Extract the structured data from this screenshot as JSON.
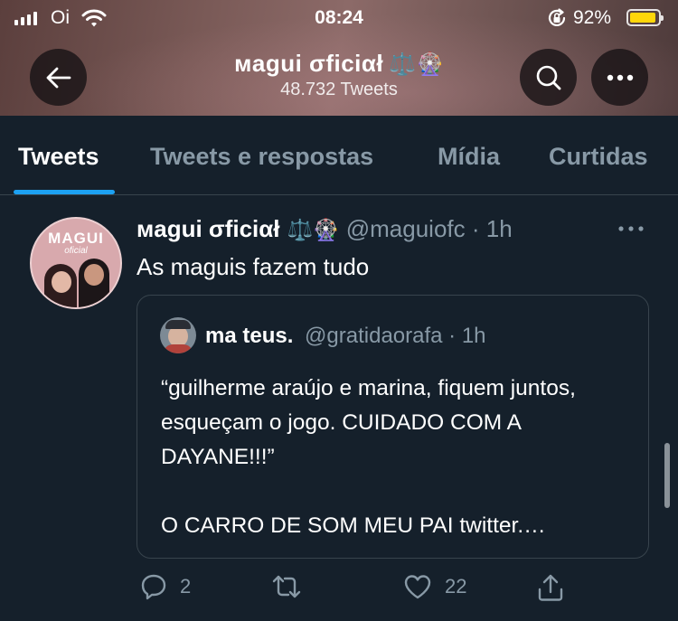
{
  "status_bar": {
    "carrier": "Oi",
    "time": "08:24",
    "battery_percent": "92%",
    "battery_level": 0.92,
    "battery_color": "#ffd60a"
  },
  "header": {
    "profile_name": "ᴍagui σficiαł",
    "profile_emoji": "⚖️🎡",
    "tweet_count": "48.732 Tweets"
  },
  "tabs": [
    {
      "label": "Tweets",
      "active": true
    },
    {
      "label": "Tweets e respostas",
      "active": false
    },
    {
      "label": "Mídia",
      "active": false
    },
    {
      "label": "Curtidas",
      "active": false
    }
  ],
  "tweet": {
    "author": "ᴍagui σficiαł",
    "author_emoji": "⚖️🎡",
    "handle": "@maguiofc · 1h",
    "text": "As maguis fazem tudo",
    "avatar_text": "MAGUI",
    "avatar_subtext": "oficial",
    "quoted": {
      "author": "ma teus.",
      "handle": "@gratidaorafa · 1h",
      "text": "“guilherme araújo e marina, fiquem juntos, esqueçam o jogo. CUIDADO COM A DAYANE!!!”\n\nO CARRO DE SOM MEU PAI twitter.…"
    },
    "actions": {
      "replies": "2",
      "retweets": "",
      "likes": "22"
    }
  },
  "colors": {
    "background": "#15202b",
    "accent": "#1da1f2",
    "muted_text": "#8899a6",
    "border": "#38444d"
  }
}
